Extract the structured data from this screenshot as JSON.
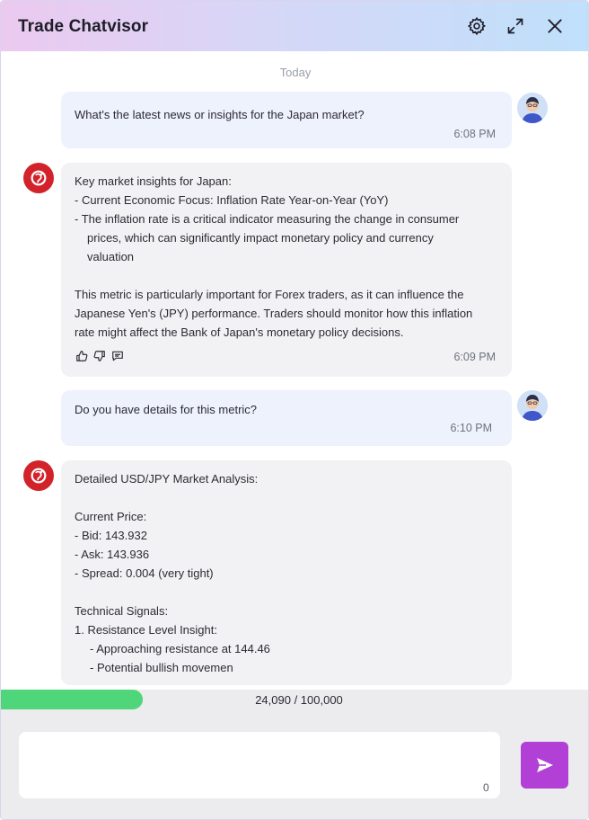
{
  "header": {
    "title": "Trade Chatvisor",
    "settings_icon": "gear-icon",
    "expand_icon": "expand-icon",
    "close_icon": "close-icon"
  },
  "chat": {
    "day_label": "Today",
    "messages": [
      {
        "role": "user",
        "lines": [
          "What's the latest news or insights for the Japan market?"
        ],
        "time": "6:08 PM"
      },
      {
        "role": "assistant",
        "lines": [
          "Key market insights for Japan:",
          "-  Current Economic Focus: Inflation Rate Year-on-Year (YoY)",
          "-  The inflation rate is a critical indicator measuring the change in consumer",
          "prices, which can significantly impact monetary policy and currency",
          "valuation",
          "",
          "This metric is particularly important for Forex traders, as it can influence the",
          "Japanese Yen's (JPY) performance. Traders should monitor how this inflation",
          "rate might affect the Bank of Japan's monetary policy decisions."
        ],
        "time": "6:09 PM",
        "actions": [
          "thumbs-up-icon",
          "thumbs-down-icon",
          "comment-icon"
        ]
      },
      {
        "role": "user",
        "lines": [
          "Do you have details for this metric?"
        ],
        "time": "6:10 PM"
      },
      {
        "role": "assistant",
        "lines": [
          "Detailed USD/JPY Market Analysis:",
          "",
          "Current Price:",
          "-  Bid: 143.932",
          "-  Ask: 143.936",
          "-  Spread: 0.004 (very tight)",
          "",
          "Technical Signals:",
          "1.  Resistance Level Insight:",
          "- Approaching resistance at 144.46",
          "- Potential bullish movemen"
        ]
      }
    ]
  },
  "usage": {
    "label": "24,090 / 100,000",
    "fraction": 0.2409,
    "color": "#4fd67a"
  },
  "composer": {
    "input_value": "",
    "placeholder": "",
    "char_count": "0",
    "send_icon": "send-icon",
    "send_color": "#b23fd6"
  }
}
